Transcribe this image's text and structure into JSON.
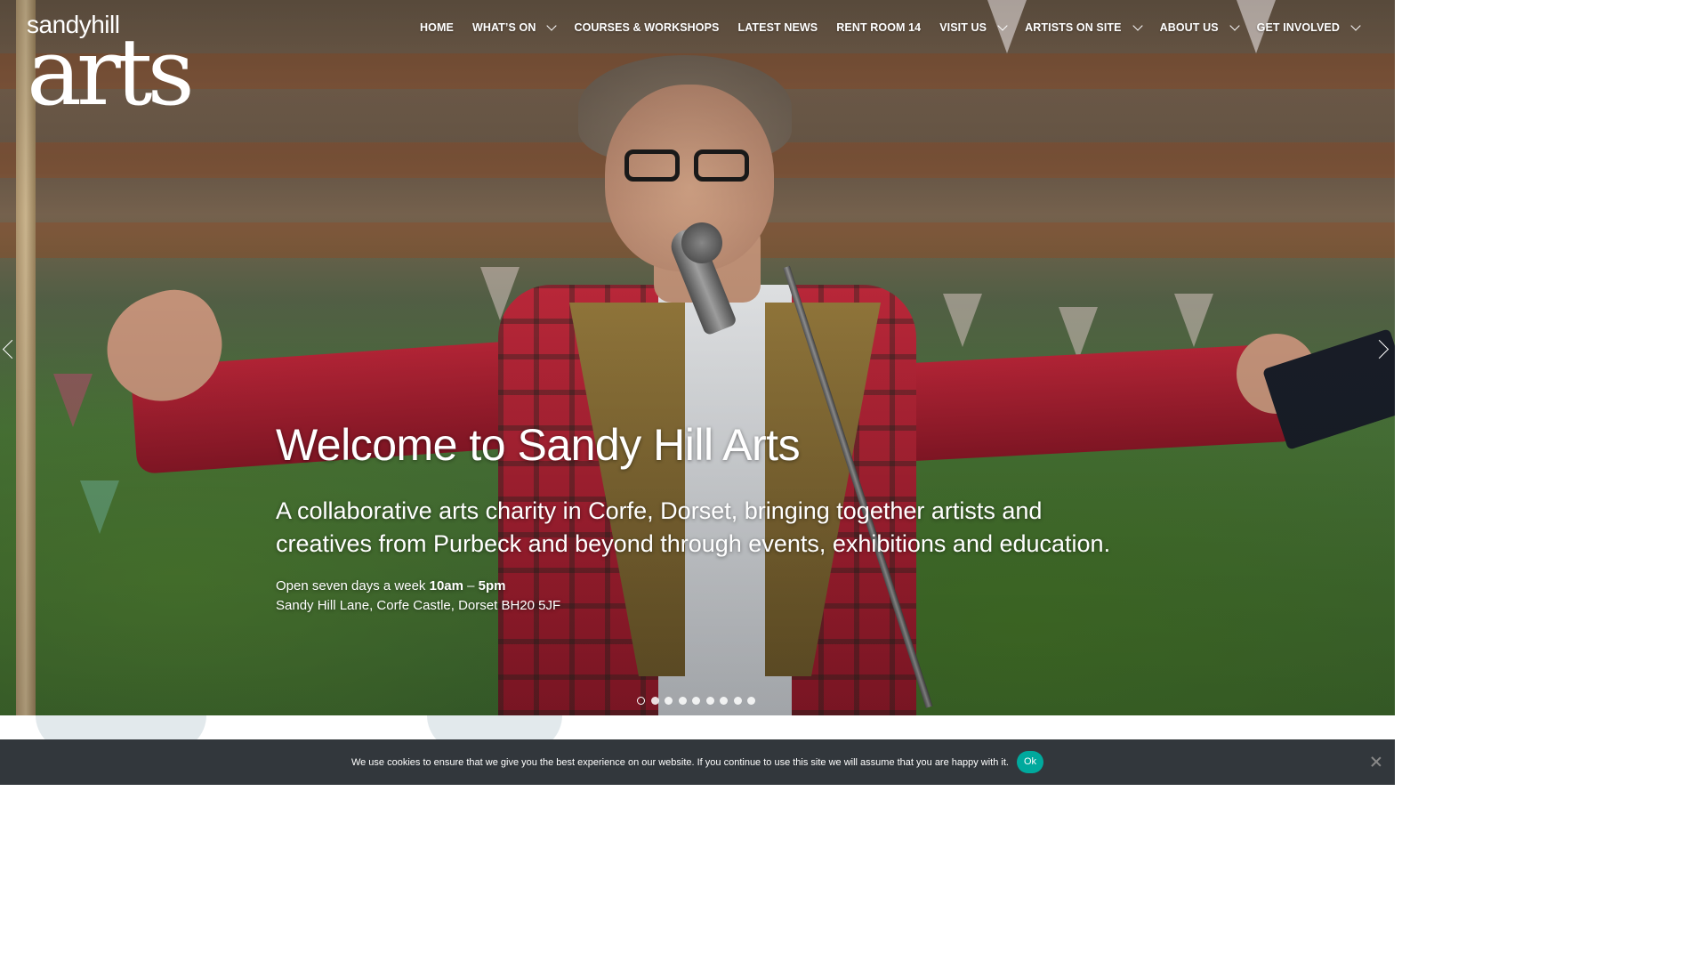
{
  "site": {
    "logo_top": "sandyhill",
    "logo_main": "arts"
  },
  "nav": {
    "items": [
      {
        "label": "HOME",
        "has_dropdown": false
      },
      {
        "label": "WHAT’S ON",
        "has_dropdown": true
      },
      {
        "label": "COURSES & WORKSHOPS",
        "has_dropdown": false
      },
      {
        "label": "LATEST NEWS",
        "has_dropdown": false
      },
      {
        "label": "RENT ROOM 14",
        "has_dropdown": false
      },
      {
        "label": "VISIT US",
        "has_dropdown": true
      },
      {
        "label": "ARTISTS ON SITE",
        "has_dropdown": true
      },
      {
        "label": "ABOUT US",
        "has_dropdown": true
      },
      {
        "label": "GET INVOLVED",
        "has_dropdown": true
      }
    ]
  },
  "hero": {
    "title": "Welcome to Sandy Hill Arts",
    "subtitle": "A collaborative arts charity in Corfe, Dorset, bringing together artists and creatives from Purbeck and beyond through events, exhibitions and education.",
    "hours_prefix": "Open seven days a week",
    "hours_open": "10am",
    "hours_sep": "–",
    "hours_close": "5pm",
    "address": "Sandy Hill Lane, Corfe Castle, Dorset BH20 5JF",
    "prev_icon": "chevron-left-icon",
    "next_icon": "chevron-right-icon"
  },
  "slider": {
    "slide_count": 9,
    "active_index": 0
  },
  "cookie": {
    "text": "We use cookies to ensure that we give you the best experience on our website. If you continue to use this site we will assume that you are happy with it.",
    "ok_label": "Ok",
    "close_icon": "close-icon"
  },
  "colors": {
    "cookie_bg": "#32373c",
    "ok_button": "#00a99d",
    "section_blob": "#e2e9ec"
  }
}
